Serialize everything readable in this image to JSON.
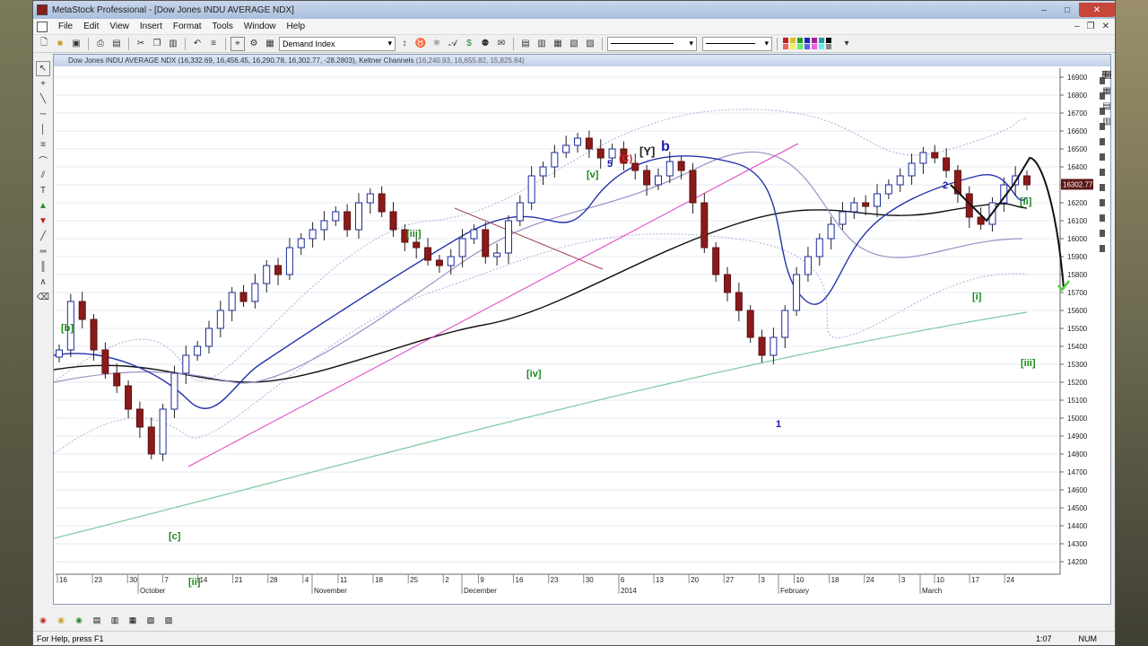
{
  "window": {
    "title": "MetaStock Professional - [Dow Jones INDU AVERAGE NDX]"
  },
  "menu": [
    "File",
    "Edit",
    "View",
    "Insert",
    "Format",
    "Tools",
    "Window",
    "Help"
  ],
  "toolbar": {
    "indicator_select": "Demand Index"
  },
  "chart": {
    "title": "Dow Jones INDU AVERAGE NDX",
    "ohlc": "(16,332.69, 16,456.45, 16,290.78, 16,302.77, -28.2803)",
    "keltner": "Keltner Channels",
    "keltner_values": "(16,240.93, 16,655.82, 15,825.84)"
  },
  "chart_data": {
    "type": "candlestick",
    "y_ticks": [
      14200,
      14300,
      14400,
      14500,
      14600,
      14700,
      14800,
      14900,
      15000,
      15100,
      15200,
      15300,
      15400,
      15500,
      15600,
      15700,
      15800,
      15900,
      16000,
      16100,
      16200,
      16300,
      16400,
      16500,
      16600,
      16700,
      16800,
      16900
    ],
    "ylim": [
      14130,
      16950
    ],
    "x_day_labels": [
      "16",
      "23",
      "30",
      "7",
      "14",
      "21",
      "28",
      "4",
      "11",
      "18",
      "25",
      "2",
      "9",
      "16",
      "23",
      "30",
      "6",
      "13",
      "20",
      "27",
      "3",
      "10",
      "18",
      "24",
      "3",
      "10",
      "17",
      "24"
    ],
    "x_month_labels": [
      "October",
      "November",
      "December",
      "2014",
      "February",
      "March"
    ],
    "current_price_label": "16302.77",
    "wave_labels": [
      {
        "text": "[b]",
        "color": "#1a8a1a"
      },
      {
        "text": "[c]",
        "color": "#1a8a1a"
      },
      {
        "text": "[ii]",
        "color": "#1a8a1a"
      },
      {
        "text": "[iii]",
        "color": "#1a8a1a"
      },
      {
        "text": "[iv]",
        "color": "#1a8a1a"
      },
      {
        "text": "[v]",
        "color": "#1a8a1a"
      },
      {
        "text": "5",
        "color": "#1a1aa8"
      },
      {
        "text": "(C)",
        "color": "#d42020"
      },
      {
        "text": "[Y]",
        "color": "#222222"
      },
      {
        "text": "b",
        "color": "#1a1aa8"
      },
      {
        "text": "1",
        "color": "#1a1aa8"
      },
      {
        "text": "2",
        "color": "#1a1aa8"
      },
      {
        "text": "[i]",
        "color": "#1a8a1a"
      },
      {
        "text": "[ii]",
        "color": "#1a8a1a"
      },
      {
        "text": "[iii]",
        "color": "#1a8a1a"
      }
    ]
  },
  "status": {
    "help": "For Help, press F1",
    "time": "1:07",
    "num": "NUM"
  }
}
